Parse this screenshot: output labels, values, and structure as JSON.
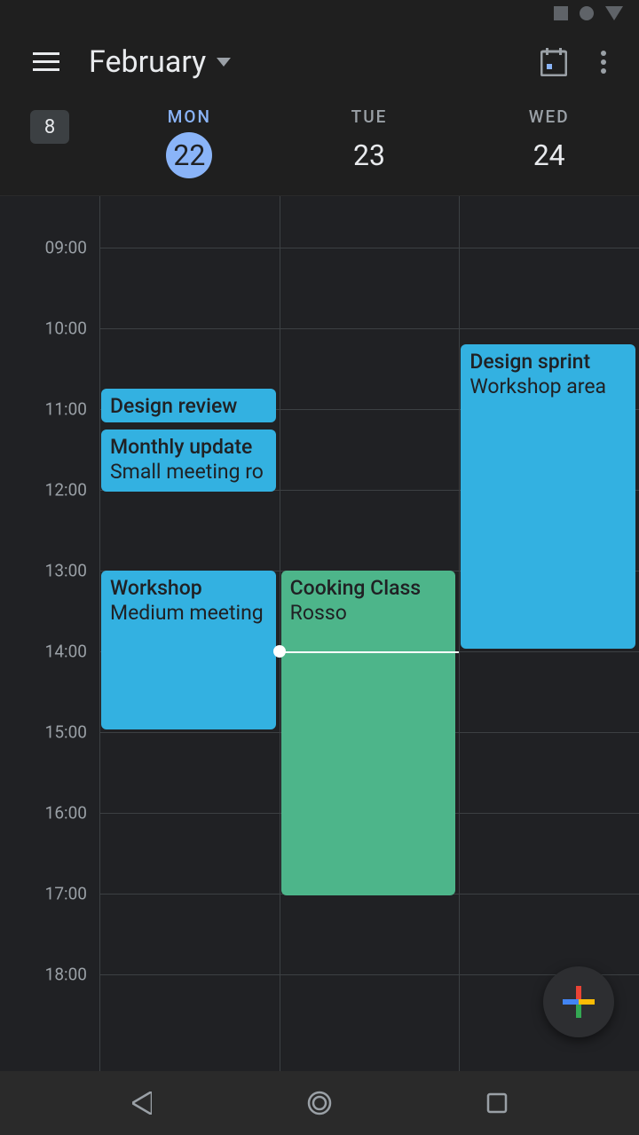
{
  "header": {
    "month_label": "February",
    "week_number": "8"
  },
  "days": [
    {
      "dow": "MON",
      "num": "22",
      "current": true
    },
    {
      "dow": "TUE",
      "num": "23",
      "current": false
    },
    {
      "dow": "WED",
      "num": "24",
      "current": false
    }
  ],
  "hours": [
    "09:00",
    "10:00",
    "11:00",
    "12:00",
    "13:00",
    "14:00",
    "15:00",
    "16:00",
    "17:00",
    "18:00"
  ],
  "now_indicator": {
    "day_index": 1,
    "hour_fraction": 14.0
  },
  "events": [
    {
      "day_index": 0,
      "start": 10.75,
      "end": 11.2,
      "title": "Design review",
      "location": "",
      "color": "#33b1e1"
    },
    {
      "day_index": 0,
      "start": 11.25,
      "end": 12.05,
      "title": "Monthly update",
      "location": "Small meeting ro",
      "color": "#33b1e1"
    },
    {
      "day_index": 0,
      "start": 13.0,
      "end": 15.0,
      "title": "Workshop",
      "location": "Medium meeting",
      "color": "#33b1e1"
    },
    {
      "day_index": 1,
      "start": 13.0,
      "end": 17.05,
      "title": "Cooking Class",
      "location": "Rosso",
      "color": "#4db58a"
    },
    {
      "day_index": 2,
      "start": 10.2,
      "end": 14.0,
      "title": "Design sprint",
      "location": "Workshop area",
      "color": "#33b1e1"
    }
  ],
  "colors": {
    "hour_height": 91,
    "first_hour": 8.36
  }
}
